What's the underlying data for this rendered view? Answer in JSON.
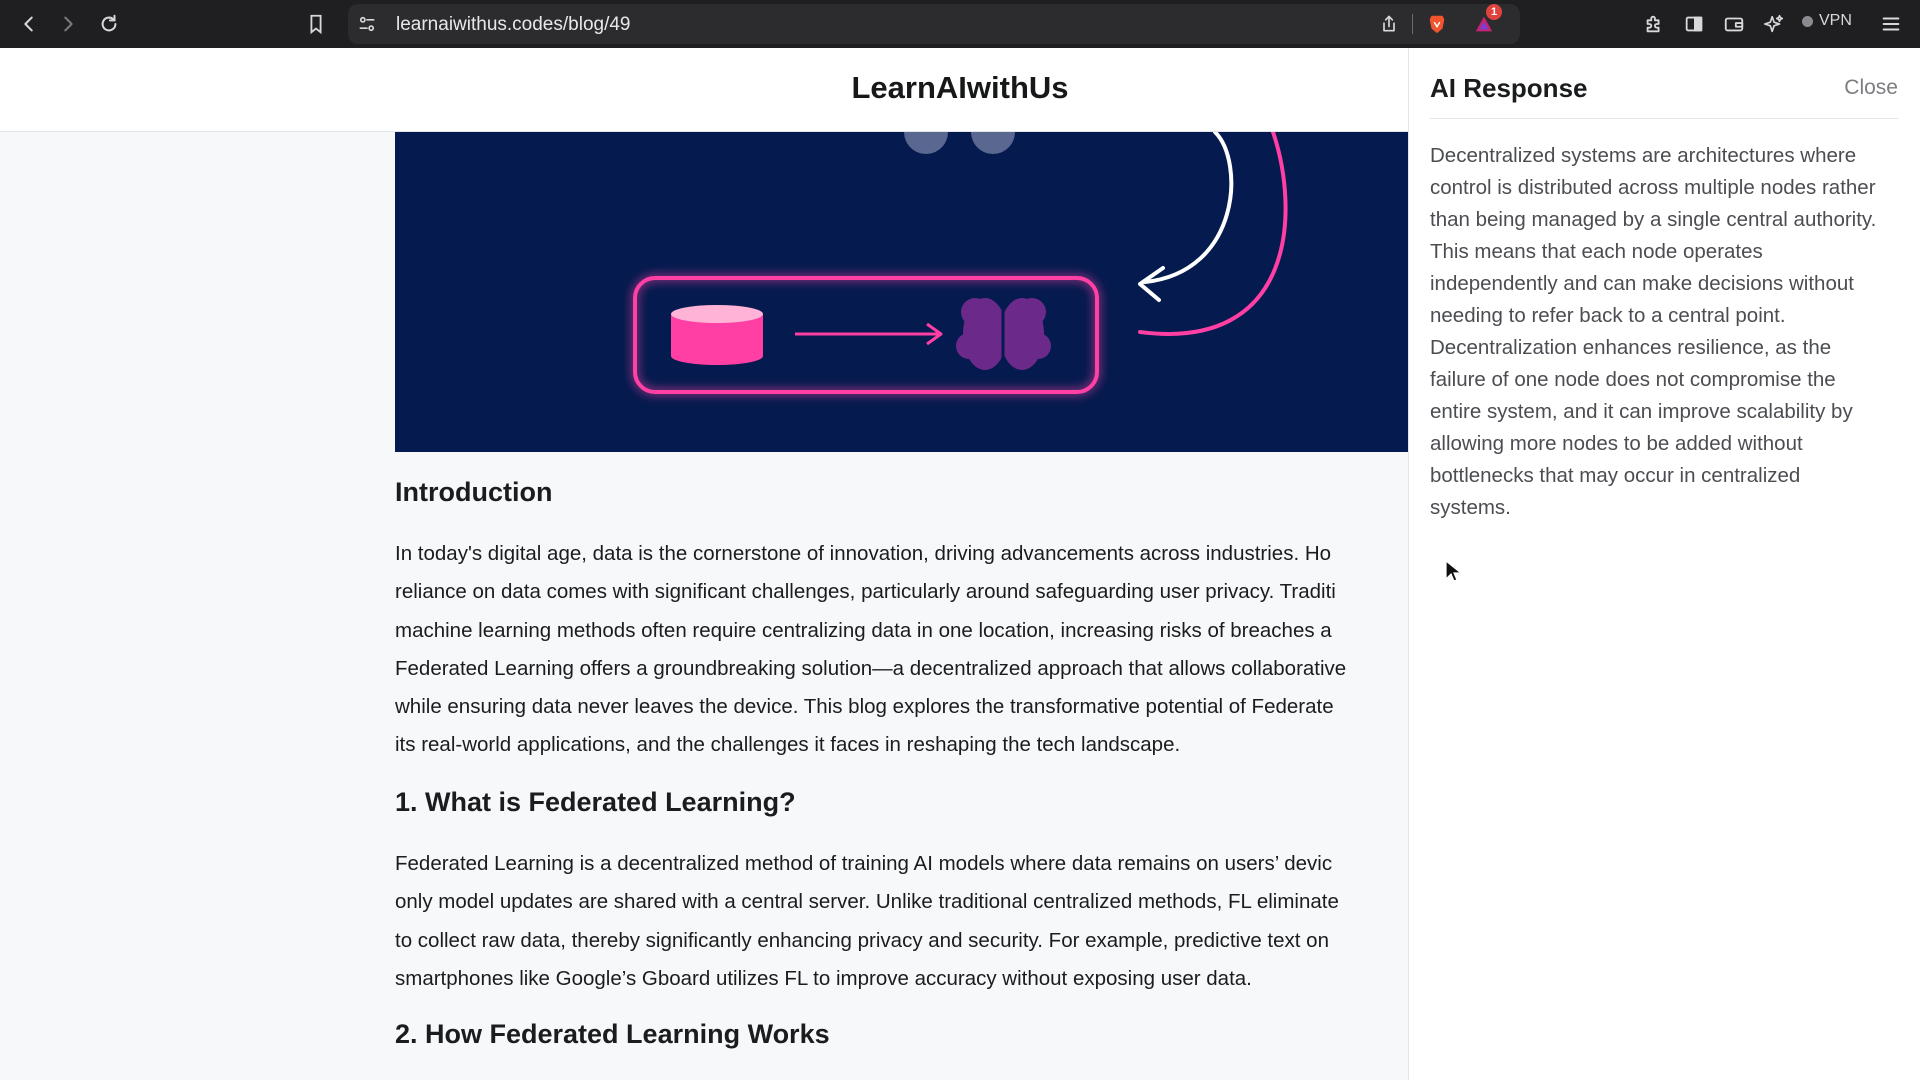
{
  "browser": {
    "url": "learnaiwithus.codes/blog/49",
    "notification_count": "1",
    "vpn_label": "VPN"
  },
  "site": {
    "title": "LearnAIwithUs"
  },
  "article": {
    "sections": [
      {
        "heading": "Introduction",
        "lines": [
          "In today's digital age, data is the cornerstone of innovation, driving advancements across industries. Ho",
          "reliance on data comes with significant challenges, particularly around safeguarding user privacy. Traditi",
          "machine learning methods often require centralizing data in one location, increasing risks of breaches a",
          "Federated Learning offers a groundbreaking solution—a decentralized approach that allows collaborative",
          "while ensuring data never leaves the device. This blog explores the transformative potential of Federate",
          "its real-world applications, and the challenges it faces in reshaping the tech landscape."
        ]
      },
      {
        "heading": "1. What is Federated Learning?",
        "lines": [
          "Federated Learning is a decentralized method of training AI models where data remains on users’ devic",
          "only model updates are shared with a central server. Unlike traditional centralized methods, FL eliminate",
          "to collect raw data, thereby significantly enhancing privacy and security. For example, predictive text on",
          "smartphones like Google’s Gboard utilizes FL to improve accuracy without exposing user data."
        ]
      },
      {
        "heading": "2. How Federated Learning Works"
      }
    ]
  },
  "ai_panel": {
    "title": "AI Response",
    "close_label": "Close",
    "lines": [
      "Decentralized systems are architectures where",
      "control is distributed across multiple nodes rather",
      "than being managed by a single central authority.",
      "This means that each node operates",
      "independently and can make decisions without",
      "needing to refer back to a central point.",
      "Decentralization enhances resilience, as the",
      "failure of one node does not compromise the",
      "entire system, and it can improve scalability by",
      "allowing more nodes to be added without",
      "bottlenecks that may occur in centralized",
      "systems."
    ]
  },
  "colors": {
    "hero_bg": "#051a4e",
    "accent_pink": "#ff3fa4",
    "brain_purple": "#6b2a8a"
  },
  "icons": [
    "back-icon",
    "forward-icon",
    "reload-icon",
    "bookmark-icon",
    "site-settings-icon",
    "share-icon",
    "brave-lion-icon",
    "brave-rewards-icon",
    "extensions-icon",
    "sidebar-icon",
    "wallet-icon",
    "leo-ai-icon",
    "menu-icon"
  ]
}
